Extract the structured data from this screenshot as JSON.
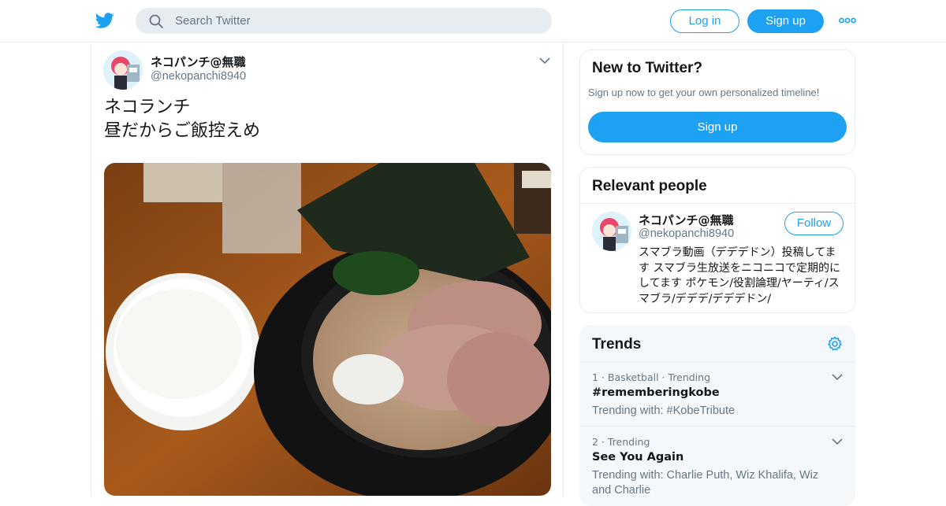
{
  "header": {
    "logo": "twitter-bird-icon",
    "search_placeholder": "Search Twitter",
    "login_label": "Log in",
    "signup_label": "Sign up",
    "more_icon": "more-dots-icon",
    "accent_color": "#1da1f2"
  },
  "tweet": {
    "display_name": "ネコパンチ@無職",
    "screen_name": "@nekopanchi8940",
    "text": "ネコランチ\n昼だからご飯控えめ",
    "photo": "ramen-and-rice-photo"
  },
  "new_to_twitter": {
    "title": "New to Twitter?",
    "subtitle": "Sign up now to get your own personalized timeline!",
    "signup_label": "Sign up"
  },
  "relevant_people": {
    "title": "Relevant people",
    "person": {
      "display_name": "ネコパンチ@無職",
      "screen_name": "@nekopanchi8940",
      "follow_label": "Follow",
      "bio": "スマブラ動画（デデデドン）投稿してます スマブラ生放送をニコニコで定期的にしてます ポケモン/役割論理/ヤーティ/スマブラ/デデデ/デデデドン/"
    }
  },
  "trends": {
    "title": "Trends",
    "items": [
      {
        "meta": "1 · Basketball · Trending",
        "name": "#rememberingkobe",
        "with": "Trending with: #KobeTribute"
      },
      {
        "meta": "2 · Trending",
        "name": "See You Again",
        "with": "Trending with: Charlie Puth, Wiz Khalifa, Wiz and Charlie"
      }
    ]
  }
}
